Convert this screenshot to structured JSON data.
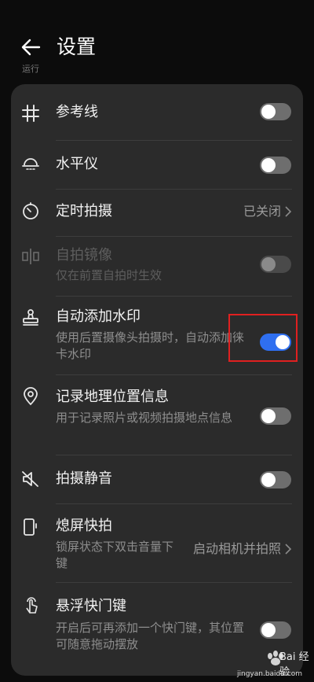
{
  "header": {
    "title": "设置",
    "cut_text": "运行"
  },
  "rows": [
    {
      "label": "参考线",
      "icon": "hash-icon",
      "control": "toggle",
      "state": "off"
    },
    {
      "label": "水平仪",
      "icon": "level-icon",
      "control": "toggle",
      "state": "off"
    },
    {
      "label": "定时拍摄",
      "icon": "timer-icon",
      "control": "value",
      "value": "已关闭"
    },
    {
      "label": "自拍镜像",
      "sub": "仅在前置自拍时生效",
      "icon": "mirror-icon",
      "control": "toggle",
      "state": "disabled"
    },
    {
      "label": "自动添加水印",
      "sub": "使用后置摄像头拍摄时，自动添加徕卡水印",
      "icon": "stamp-icon",
      "control": "toggle",
      "state": "on"
    },
    {
      "label": "记录地理位置信息",
      "sub": "用于记录照片或视频拍摄地点信息",
      "icon": "location-pin-icon",
      "control": "toggle",
      "state": "off"
    },
    {
      "label": "拍摄静音",
      "icon": "mute-icon",
      "control": "toggle",
      "state": "off"
    },
    {
      "label": "熄屏快拍",
      "sub": "锁屏状态下双击音量下键",
      "icon": "phone-side-icon",
      "control": "value",
      "value": "启动相机并拍照"
    },
    {
      "label": "悬浮快门键",
      "sub": "开启后可再添加一个快门键，其位置可随意拖动摆放",
      "icon": "touch-icon",
      "control": "toggle",
      "state": "off"
    }
  ],
  "watermark": {
    "text": "Bai 经验",
    "url": "jingyan.baidu.com"
  },
  "colors": {
    "accent": "#2f6ff0",
    "highlight": "#e02020",
    "card": "#2b2b2b"
  }
}
